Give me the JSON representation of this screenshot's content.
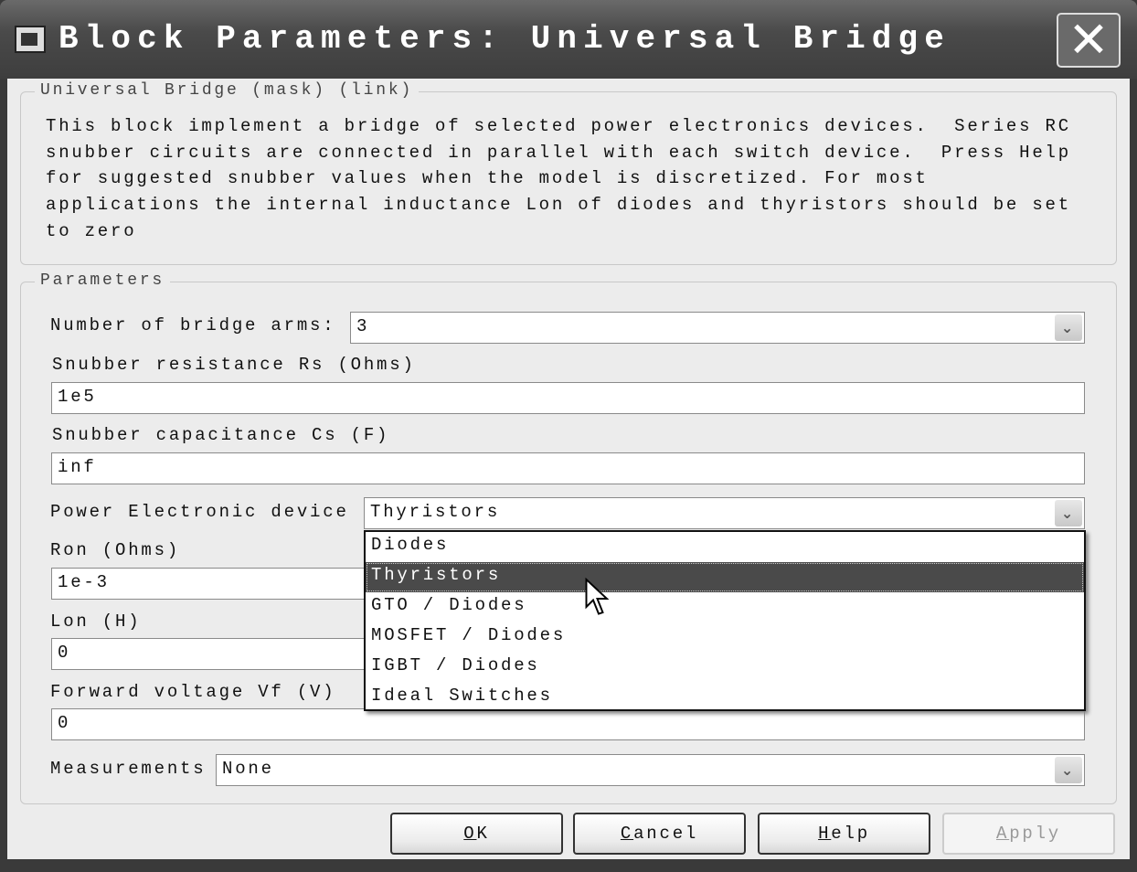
{
  "window": {
    "title": "Block Parameters: Universal Bridge",
    "close_icon": "close-icon"
  },
  "description_group": {
    "legend": "Universal Bridge (mask) (link)",
    "lines": [
      "This block implement a bridge of selected power electronics devices.  Series RC",
      "snubber circuits are connected in parallel with each switch device.  Press Help",
      "for suggested snubber values when the model is discretized. For most",
      "applications the internal inductance Lon of diodes and thyristors should be set",
      "to zero"
    ]
  },
  "parameters": {
    "legend": "Parameters",
    "bridge_arms": {
      "label": "Number of bridge arms:",
      "value": "3"
    },
    "rs": {
      "label": "Snubber resistance Rs (Ohms)",
      "value": "1e5"
    },
    "cs": {
      "label": "Snubber capacitance Cs (F)",
      "value": "inf"
    },
    "device": {
      "label": "Power Electronic device",
      "value": "Thyristors",
      "options": [
        "Diodes",
        "Thyristors",
        "GTO / Diodes",
        "MOSFET / Diodes",
        "IGBT / Diodes",
        "Ideal Switches"
      ]
    },
    "ron": {
      "label": "Ron (Ohms)",
      "value": "1e-3"
    },
    "lon": {
      "label": "Lon (H)",
      "value": "0"
    },
    "vf": {
      "label": "Forward voltage Vf (V)",
      "value": "0"
    },
    "measurements": {
      "label": "Measurements",
      "value": "None"
    }
  },
  "buttons": {
    "ok": {
      "u": "O",
      "rest": "K"
    },
    "cancel": {
      "u": "C",
      "rest": "ancel"
    },
    "help": {
      "u": "H",
      "rest": "elp"
    },
    "apply": {
      "u": "A",
      "rest": "pply"
    }
  }
}
